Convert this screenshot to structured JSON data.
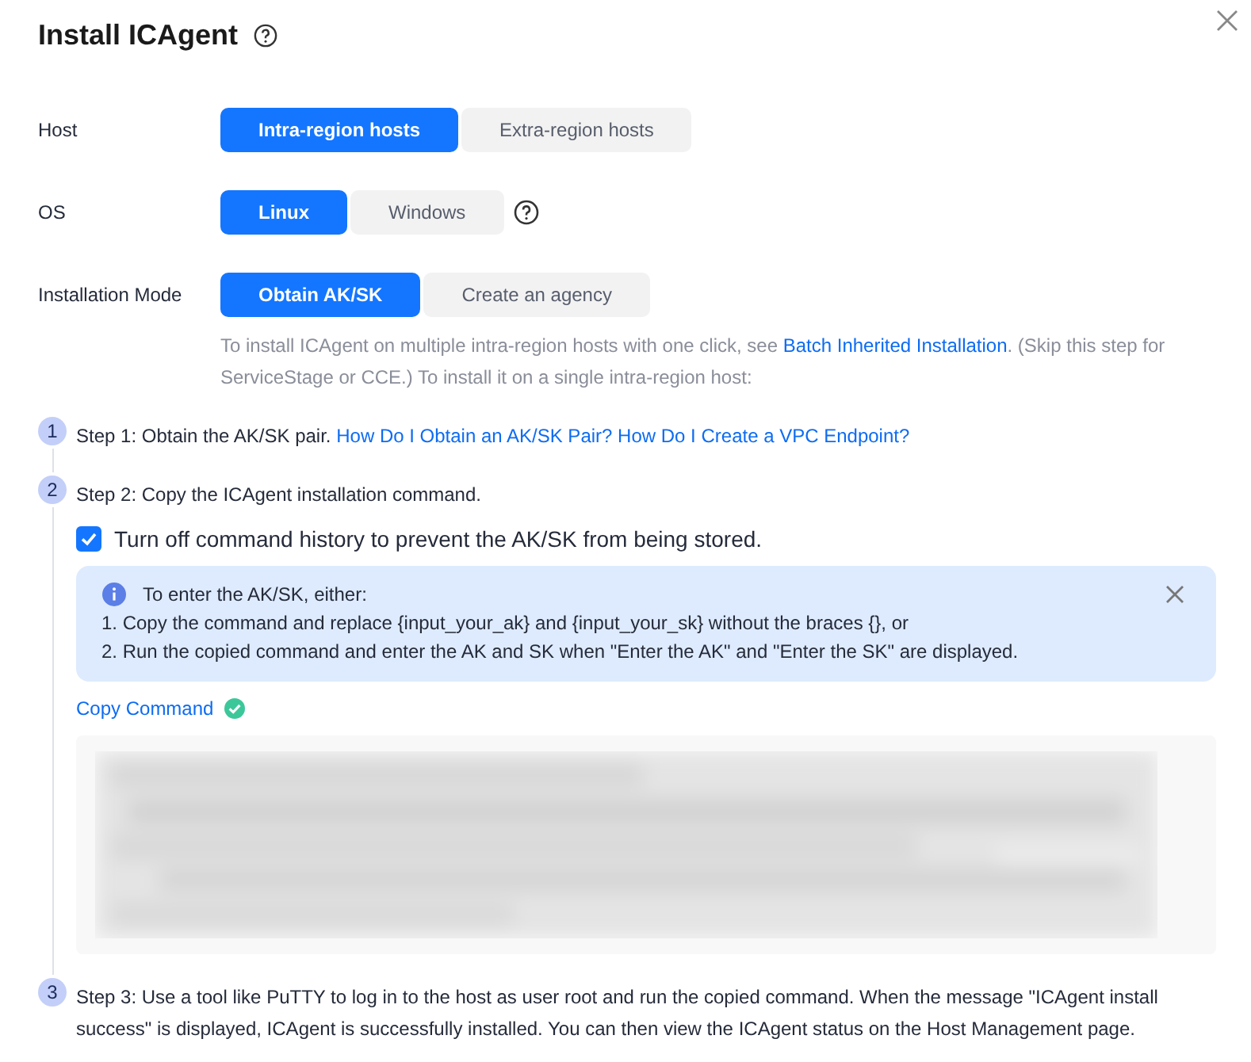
{
  "title": "Install ICAgent",
  "form": [
    {
      "label": "Host",
      "options": [
        {
          "label": "Intra-region hosts",
          "selected": true
        },
        {
          "label": "Extra-region hosts",
          "selected": false
        }
      ],
      "help": false
    },
    {
      "label": "OS",
      "options": [
        {
          "label": "Linux",
          "selected": true
        },
        {
          "label": "Windows",
          "selected": false
        }
      ],
      "help": true
    },
    {
      "label": "Installation Mode",
      "options": [
        {
          "label": "Obtain AK/SK",
          "selected": true
        },
        {
          "label": "Create an agency",
          "selected": false
        }
      ],
      "help": false
    }
  ],
  "description": {
    "before": "To install ICAgent on multiple intra-region hosts with one click, see ",
    "link": "Batch Inherited Installation",
    "after": ". (Skip this step for ServiceStage or CCE.) To install it on a single intra-region host:"
  },
  "steps": [
    {
      "number": "1",
      "text": "Step 1: Obtain the AK/SK pair.",
      "links": [
        "How Do I Obtain an AK/SK Pair?",
        "How Do I Create a VPC Endpoint?"
      ]
    },
    {
      "number": "2",
      "text": "Step 2: Copy the ICAgent installation command.",
      "checkbox": {
        "label": "Turn off command history to prevent the AK/SK from being stored.",
        "checked": true
      },
      "alert": {
        "title": "To enter the AK/SK, either:",
        "lines": [
          "1. Copy the command and replace {input_your_ak} and {input_your_sk} without the braces {}, or",
          "2. Run the copied command and enter the AK and SK when \"Enter the AK\" and \"Enter the SK\" are displayed."
        ]
      },
      "copy": {
        "label": "Copy Command",
        "copied": true
      }
    },
    {
      "number": "3",
      "text": "Step 3: Use a tool like PuTTY to log in to the host as user root and run the copied command. When the message \"ICAgent install success\" is displayed, ICAgent is successfully installed. You can then view the ICAgent status on the Host Management page."
    }
  ]
}
